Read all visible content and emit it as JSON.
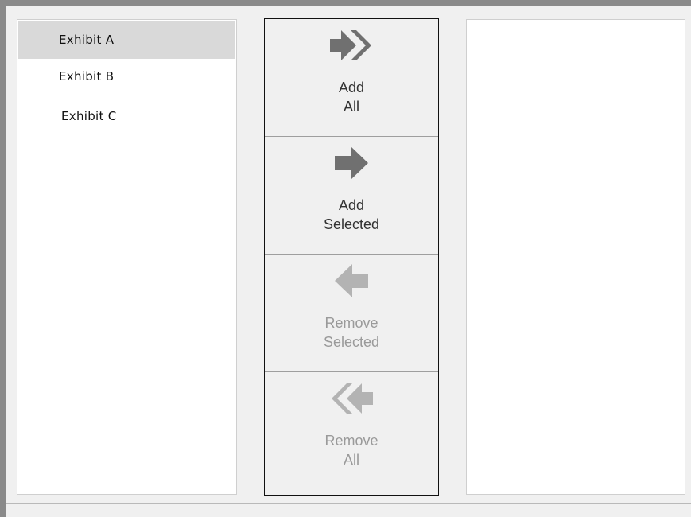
{
  "source_list": {
    "items": [
      {
        "label": "Exhibit A",
        "selected": true
      },
      {
        "label": "Exhibit B",
        "selected": false
      },
      {
        "label": "Exhibit C",
        "selected": false
      }
    ]
  },
  "target_list": {
    "items": []
  },
  "buttons": {
    "add_all": {
      "line1": "Add",
      "line2": "All",
      "enabled": true,
      "icon": "double-arrow-right-icon"
    },
    "add_selected": {
      "line1": "Add",
      "line2": "Selected",
      "enabled": true,
      "icon": "arrow-right-icon"
    },
    "remove_selected": {
      "line1": "Remove",
      "line2": "Selected",
      "enabled": false,
      "icon": "arrow-left-icon"
    },
    "remove_all": {
      "line1": "Remove",
      "line2": "All",
      "enabled": false,
      "icon": "double-arrow-left-icon"
    }
  },
  "colors": {
    "enabled_icon": "#707070",
    "disabled_icon": "#b3b3b3",
    "selected_row": "#d9d9d9"
  }
}
